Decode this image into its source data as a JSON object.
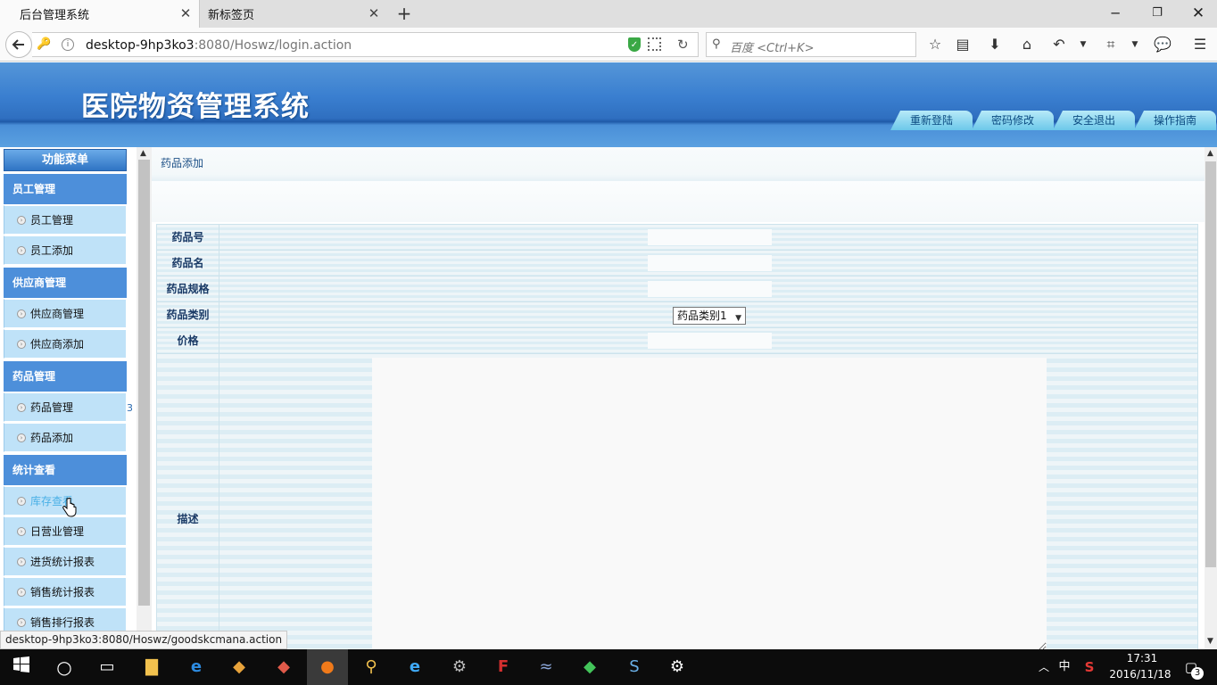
{
  "browser": {
    "tabs": [
      {
        "label": "后台管理系统",
        "active": true
      },
      {
        "label": "新标签页",
        "active": false
      }
    ],
    "new_tab_icon": "+",
    "url_host": "desktop-9hp3ko3",
    "url_rest": ":8080/Hoswz/login.action",
    "search_placeholder": "百度 <Ctrl+K>",
    "status_url": "desktop-9hp3ko3:8080/Hoswz/goodskcmana.action"
  },
  "site": {
    "title": "医院物资管理系统",
    "header_buttons": [
      "重新登陆",
      "密码修改",
      "安全退出",
      "操作指南"
    ]
  },
  "sidebar": {
    "title": "功能菜单",
    "groups": [
      {
        "label": "员工管理",
        "items": [
          "员工管理",
          "员工添加"
        ]
      },
      {
        "label": "供应商管理",
        "items": [
          "供应商管理",
          "供应商添加"
        ]
      },
      {
        "label": "药品管理",
        "items": [
          "药品管理",
          "药品添加"
        ]
      },
      {
        "label": "统计查看",
        "items": [
          "库存查看",
          "日营业管理",
          "进货统计报表",
          "销售统计报表",
          "销售排行报表"
        ]
      }
    ],
    "collapse_marker": "3"
  },
  "main": {
    "breadcrumb": "药品添加",
    "form": {
      "drug_no_label": "药品号",
      "drug_name_label": "药品名",
      "drug_spec_label": "药品规格",
      "drug_category_label": "药品类别",
      "drug_category_value": "药品类别1",
      "price_label": "价格",
      "description_label": "描述"
    }
  },
  "taskbar": {
    "time": "17:31",
    "date": "2016/11/18",
    "ime": "中",
    "notifications": "3"
  },
  "colors": {
    "header_blue": "#3a7fd0",
    "menu_group": "#4d8fda",
    "menu_item": "#bfe2f8",
    "header_button": "#6cc8ea"
  }
}
